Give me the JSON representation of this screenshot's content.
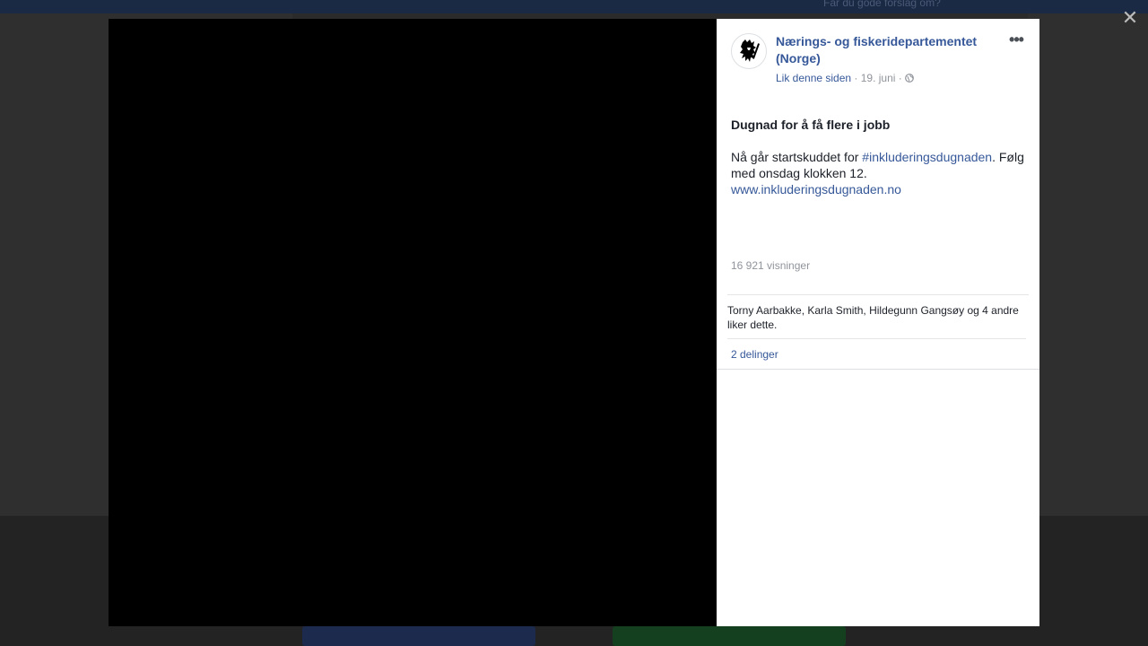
{
  "background": {
    "topbar_text": "Får du gode forslag om?"
  },
  "viewer": {
    "close_glyph": "✕"
  },
  "post": {
    "page_name": "Nærings- og fiskeridepartementet (Norge)",
    "avatar_icon": "lion-crest-icon",
    "more_glyph": "•••",
    "like_page_label": "Lik denne siden",
    "separator": " · ",
    "date": "19. juni",
    "privacy_icon": "globe-icon",
    "title": "Dugnad for å få flere i jobb",
    "body_prefix": "Nå går startskuddet for ",
    "hashtag": "#inkluderingsdugnaden",
    "body_suffix": ". Følg med onsdag klokken 12.",
    "link": "www.inkluderingsdugnaden.no",
    "views": "16 921 visninger",
    "likes_text": "Torny Aarbakke, Karla Smith, Hildegunn Gangsøy og 4 andre liker dette.",
    "shares": "2 delinger"
  },
  "colors": {
    "link_blue": "#365899",
    "meta_gray": "#90949c",
    "text_dark": "#1d2129"
  }
}
